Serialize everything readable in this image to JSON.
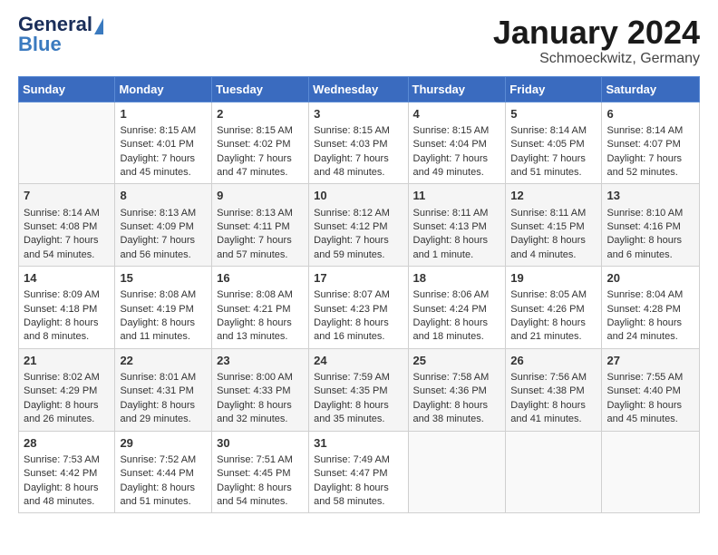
{
  "logo": {
    "general": "General",
    "blue": "Blue"
  },
  "header": {
    "month": "January 2024",
    "location": "Schmoeckwitz, Germany"
  },
  "days_of_week": [
    "Sunday",
    "Monday",
    "Tuesday",
    "Wednesday",
    "Thursday",
    "Friday",
    "Saturday"
  ],
  "weeks": [
    [
      {
        "day": "",
        "info": ""
      },
      {
        "day": "1",
        "info": "Sunrise: 8:15 AM\nSunset: 4:01 PM\nDaylight: 7 hours and 45 minutes."
      },
      {
        "day": "2",
        "info": "Sunrise: 8:15 AM\nSunset: 4:02 PM\nDaylight: 7 hours and 47 minutes."
      },
      {
        "day": "3",
        "info": "Sunrise: 8:15 AM\nSunset: 4:03 PM\nDaylight: 7 hours and 48 minutes."
      },
      {
        "day": "4",
        "info": "Sunrise: 8:15 AM\nSunset: 4:04 PM\nDaylight: 7 hours and 49 minutes."
      },
      {
        "day": "5",
        "info": "Sunrise: 8:14 AM\nSunset: 4:05 PM\nDaylight: 7 hours and 51 minutes."
      },
      {
        "day": "6",
        "info": "Sunrise: 8:14 AM\nSunset: 4:07 PM\nDaylight: 7 hours and 52 minutes."
      }
    ],
    [
      {
        "day": "7",
        "info": "Sunrise: 8:14 AM\nSunset: 4:08 PM\nDaylight: 7 hours and 54 minutes."
      },
      {
        "day": "8",
        "info": "Sunrise: 8:13 AM\nSunset: 4:09 PM\nDaylight: 7 hours and 56 minutes."
      },
      {
        "day": "9",
        "info": "Sunrise: 8:13 AM\nSunset: 4:11 PM\nDaylight: 7 hours and 57 minutes."
      },
      {
        "day": "10",
        "info": "Sunrise: 8:12 AM\nSunset: 4:12 PM\nDaylight: 7 hours and 59 minutes."
      },
      {
        "day": "11",
        "info": "Sunrise: 8:11 AM\nSunset: 4:13 PM\nDaylight: 8 hours and 1 minute."
      },
      {
        "day": "12",
        "info": "Sunrise: 8:11 AM\nSunset: 4:15 PM\nDaylight: 8 hours and 4 minutes."
      },
      {
        "day": "13",
        "info": "Sunrise: 8:10 AM\nSunset: 4:16 PM\nDaylight: 8 hours and 6 minutes."
      }
    ],
    [
      {
        "day": "14",
        "info": "Sunrise: 8:09 AM\nSunset: 4:18 PM\nDaylight: 8 hours and 8 minutes."
      },
      {
        "day": "15",
        "info": "Sunrise: 8:08 AM\nSunset: 4:19 PM\nDaylight: 8 hours and 11 minutes."
      },
      {
        "day": "16",
        "info": "Sunrise: 8:08 AM\nSunset: 4:21 PM\nDaylight: 8 hours and 13 minutes."
      },
      {
        "day": "17",
        "info": "Sunrise: 8:07 AM\nSunset: 4:23 PM\nDaylight: 8 hours and 16 minutes."
      },
      {
        "day": "18",
        "info": "Sunrise: 8:06 AM\nSunset: 4:24 PM\nDaylight: 8 hours and 18 minutes."
      },
      {
        "day": "19",
        "info": "Sunrise: 8:05 AM\nSunset: 4:26 PM\nDaylight: 8 hours and 21 minutes."
      },
      {
        "day": "20",
        "info": "Sunrise: 8:04 AM\nSunset: 4:28 PM\nDaylight: 8 hours and 24 minutes."
      }
    ],
    [
      {
        "day": "21",
        "info": "Sunrise: 8:02 AM\nSunset: 4:29 PM\nDaylight: 8 hours and 26 minutes."
      },
      {
        "day": "22",
        "info": "Sunrise: 8:01 AM\nSunset: 4:31 PM\nDaylight: 8 hours and 29 minutes."
      },
      {
        "day": "23",
        "info": "Sunrise: 8:00 AM\nSunset: 4:33 PM\nDaylight: 8 hours and 32 minutes."
      },
      {
        "day": "24",
        "info": "Sunrise: 7:59 AM\nSunset: 4:35 PM\nDaylight: 8 hours and 35 minutes."
      },
      {
        "day": "25",
        "info": "Sunrise: 7:58 AM\nSunset: 4:36 PM\nDaylight: 8 hours and 38 minutes."
      },
      {
        "day": "26",
        "info": "Sunrise: 7:56 AM\nSunset: 4:38 PM\nDaylight: 8 hours and 41 minutes."
      },
      {
        "day": "27",
        "info": "Sunrise: 7:55 AM\nSunset: 4:40 PM\nDaylight: 8 hours and 45 minutes."
      }
    ],
    [
      {
        "day": "28",
        "info": "Sunrise: 7:53 AM\nSunset: 4:42 PM\nDaylight: 8 hours and 48 minutes."
      },
      {
        "day": "29",
        "info": "Sunrise: 7:52 AM\nSunset: 4:44 PM\nDaylight: 8 hours and 51 minutes."
      },
      {
        "day": "30",
        "info": "Sunrise: 7:51 AM\nSunset: 4:45 PM\nDaylight: 8 hours and 54 minutes."
      },
      {
        "day": "31",
        "info": "Sunrise: 7:49 AM\nSunset: 4:47 PM\nDaylight: 8 hours and 58 minutes."
      },
      {
        "day": "",
        "info": ""
      },
      {
        "day": "",
        "info": ""
      },
      {
        "day": "",
        "info": ""
      }
    ]
  ]
}
